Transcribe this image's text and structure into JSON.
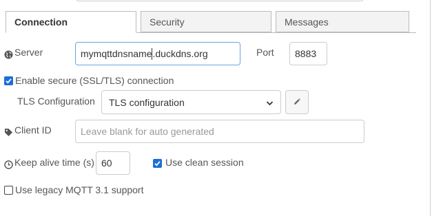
{
  "tabs": [
    {
      "label": "Connection",
      "active": true
    },
    {
      "label": "Security",
      "active": false
    },
    {
      "label": "Messages",
      "active": false
    }
  ],
  "server": {
    "label": "Server",
    "value_before_caret": "mymqttdnsname",
    "value_after_caret": ".duckdns.org",
    "icon": "globe-icon"
  },
  "port": {
    "label": "Port",
    "value": "8883"
  },
  "tls_enable": {
    "label": "Enable secure (SSL/TLS) connection",
    "checked": true
  },
  "tls_config": {
    "label": "TLS Configuration",
    "selected": "TLS configuration",
    "edit_icon": "pencil-icon"
  },
  "client_id": {
    "label": "Client ID",
    "placeholder": "Leave blank for auto generated",
    "icon": "tag-icon"
  },
  "keepalive": {
    "label": "Keep alive time (s)",
    "value": "60",
    "icon": "clock-icon"
  },
  "clean_session": {
    "label": "Use clean session",
    "checked": true
  },
  "legacy": {
    "label": "Use legacy MQTT 3.1 support",
    "checked": false
  },
  "colors": {
    "checkbox_accent": "#1c6fd6",
    "focus_border": "#6ba0e6"
  }
}
